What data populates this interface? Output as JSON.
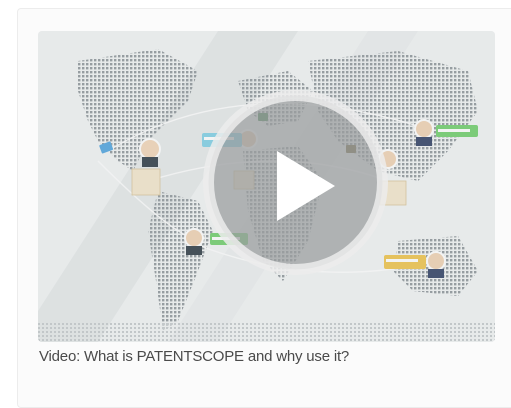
{
  "video": {
    "caption": "Video: What is PATENTSCOPE and why use it?",
    "thumbnail_icon": "world-map-network-icon",
    "play_icon": "play-icon"
  },
  "colors": {
    "map_dots": "#9aa1a4",
    "overlay": "#b9bbbd",
    "play_ring": "#e9e9e9",
    "accent_teal": "#3fbcb4",
    "accent_green": "#6fcf6b",
    "accent_blue": "#4fa4e0",
    "accent_yellow": "#f0c44a"
  }
}
